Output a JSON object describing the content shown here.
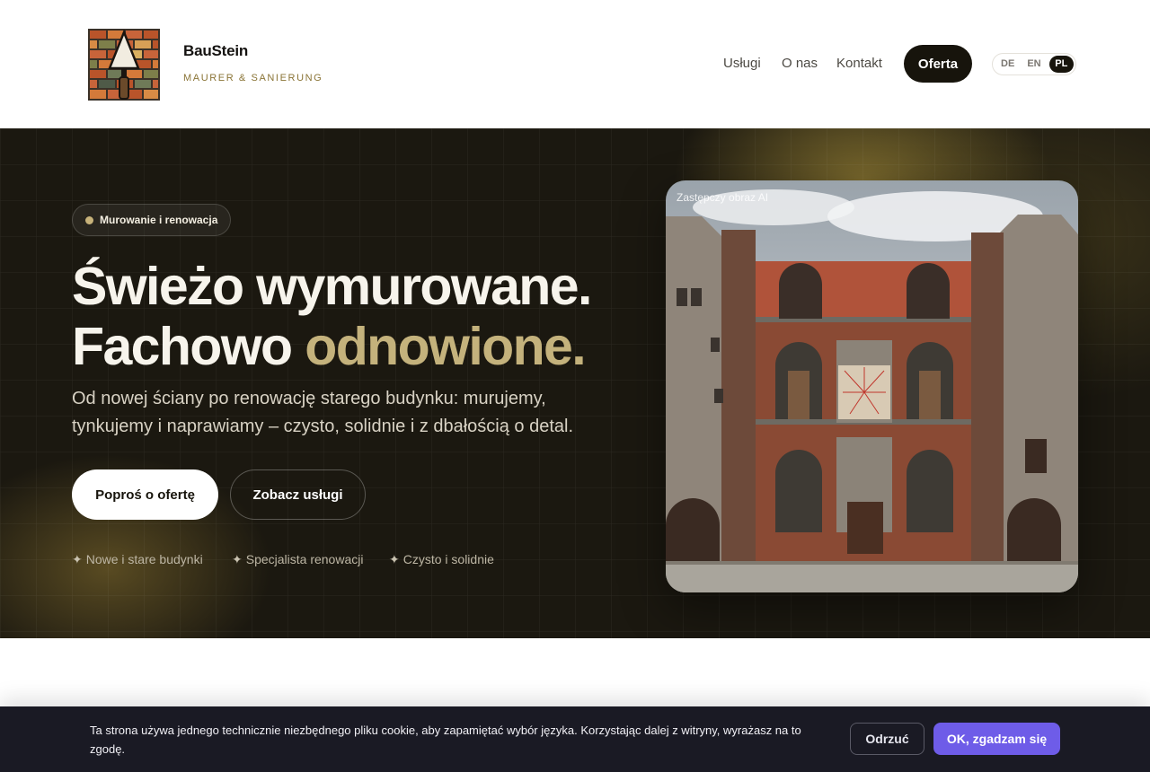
{
  "header": {
    "brand_name": "BauStein",
    "brand_tagline": "MAURER & SANIERUNG",
    "nav": [
      {
        "label": "Usługi"
      },
      {
        "label": "O nas"
      },
      {
        "label": "Kontakt"
      }
    ],
    "offer_label": "Oferta",
    "languages": [
      "DE",
      "EN",
      "PL"
    ],
    "active_language": "PL"
  },
  "hero": {
    "badge": "Murowanie i renowacja",
    "title_line1": "Świeżo wymurowane.",
    "title_line2_plain": "Fachowo ",
    "title_line2_accent": "odnowione.",
    "lead": "Od nowej ściany po renowację starego budynku: murujemy, tynkujemy i naprawiamy – czysto, solidnie i z dbałością o detal.",
    "primary_cta": "Poproś o ofertę",
    "secondary_cta": "Zobacz usługi",
    "features": [
      {
        "icon": "✦",
        "label": "Nowe i stare budynki"
      },
      {
        "icon": "✦",
        "label": "Specjalista renowacji"
      },
      {
        "icon": "✦",
        "label": "Czysto i solidnie"
      }
    ],
    "image_label": "Zastępczy obraz AI"
  },
  "cookie": {
    "text": "Ta strona używa jednego technicznie niezbędnego pliku cookie, aby zapamiętać wybór języka. Korzystając dalej z witryny, wyrażasz na to zgodę.",
    "decline": "Odrzuć",
    "accept": "OK, zgadzam się"
  },
  "colors": {
    "hero_bg": "#1b1810",
    "accent_gold": "#c4b27c",
    "cookie_accept": "#6e5ce8",
    "dark_button": "#17140c"
  }
}
